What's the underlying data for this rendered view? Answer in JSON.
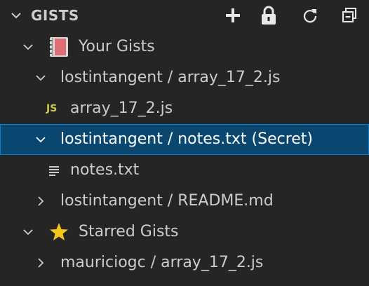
{
  "header": {
    "title": "GISTS",
    "actions": [
      {
        "icon": "plus-icon",
        "label": "New Gist"
      },
      {
        "icon": "lock-icon",
        "label": "New Secret Gist"
      },
      {
        "icon": "refresh-icon",
        "label": "Refresh"
      },
      {
        "icon": "collapse-all-icon",
        "label": "Collapse All"
      }
    ]
  },
  "tree": {
    "your_gists": {
      "label": "Your Gists",
      "icon": "notebook-icon",
      "expanded": true
    },
    "gist1": {
      "label": "lostintangent / array_17_2.js",
      "expanded": true
    },
    "gist1_file": {
      "label": "array_17_2.js",
      "badge": "JS"
    },
    "gist2": {
      "label": "lostintangent / notes.txt (Secret)",
      "expanded": true,
      "selected": true
    },
    "gist2_file": {
      "label": "notes.txt",
      "icon": "text-file-icon"
    },
    "gist3": {
      "label": "lostintangent / README.md",
      "expanded": false
    },
    "starred": {
      "label": "Starred Gists",
      "icon": "star-icon",
      "expanded": true
    },
    "starred_gist1": {
      "label": "mauriciogc / array_17_2.js",
      "expanded": false
    }
  },
  "colors": {
    "background": "#252526",
    "selected_background": "#094771",
    "selected_border": "#007fd4",
    "text": "#cccccc",
    "js_badge": "#cbcb41",
    "star": "#f5c518"
  }
}
